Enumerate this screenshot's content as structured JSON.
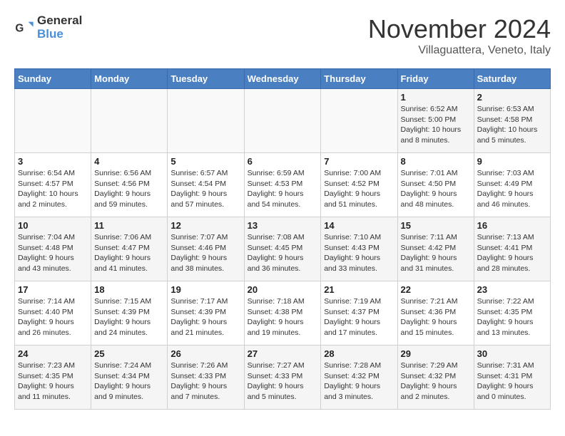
{
  "logo": {
    "line1": "General",
    "line2": "Blue"
  },
  "title": "November 2024",
  "subtitle": "Villaguattera, Veneto, Italy",
  "weekdays": [
    "Sunday",
    "Monday",
    "Tuesday",
    "Wednesday",
    "Thursday",
    "Friday",
    "Saturday"
  ],
  "weeks": [
    [
      {
        "day": "",
        "info": ""
      },
      {
        "day": "",
        "info": ""
      },
      {
        "day": "",
        "info": ""
      },
      {
        "day": "",
        "info": ""
      },
      {
        "day": "",
        "info": ""
      },
      {
        "day": "1",
        "info": "Sunrise: 6:52 AM\nSunset: 5:00 PM\nDaylight: 10 hours and 8 minutes."
      },
      {
        "day": "2",
        "info": "Sunrise: 6:53 AM\nSunset: 4:58 PM\nDaylight: 10 hours and 5 minutes."
      }
    ],
    [
      {
        "day": "3",
        "info": "Sunrise: 6:54 AM\nSunset: 4:57 PM\nDaylight: 10 hours and 2 minutes."
      },
      {
        "day": "4",
        "info": "Sunrise: 6:56 AM\nSunset: 4:56 PM\nDaylight: 9 hours and 59 minutes."
      },
      {
        "day": "5",
        "info": "Sunrise: 6:57 AM\nSunset: 4:54 PM\nDaylight: 9 hours and 57 minutes."
      },
      {
        "day": "6",
        "info": "Sunrise: 6:59 AM\nSunset: 4:53 PM\nDaylight: 9 hours and 54 minutes."
      },
      {
        "day": "7",
        "info": "Sunrise: 7:00 AM\nSunset: 4:52 PM\nDaylight: 9 hours and 51 minutes."
      },
      {
        "day": "8",
        "info": "Sunrise: 7:01 AM\nSunset: 4:50 PM\nDaylight: 9 hours and 48 minutes."
      },
      {
        "day": "9",
        "info": "Sunrise: 7:03 AM\nSunset: 4:49 PM\nDaylight: 9 hours and 46 minutes."
      }
    ],
    [
      {
        "day": "10",
        "info": "Sunrise: 7:04 AM\nSunset: 4:48 PM\nDaylight: 9 hours and 43 minutes."
      },
      {
        "day": "11",
        "info": "Sunrise: 7:06 AM\nSunset: 4:47 PM\nDaylight: 9 hours and 41 minutes."
      },
      {
        "day": "12",
        "info": "Sunrise: 7:07 AM\nSunset: 4:46 PM\nDaylight: 9 hours and 38 minutes."
      },
      {
        "day": "13",
        "info": "Sunrise: 7:08 AM\nSunset: 4:45 PM\nDaylight: 9 hours and 36 minutes."
      },
      {
        "day": "14",
        "info": "Sunrise: 7:10 AM\nSunset: 4:43 PM\nDaylight: 9 hours and 33 minutes."
      },
      {
        "day": "15",
        "info": "Sunrise: 7:11 AM\nSunset: 4:42 PM\nDaylight: 9 hours and 31 minutes."
      },
      {
        "day": "16",
        "info": "Sunrise: 7:13 AM\nSunset: 4:41 PM\nDaylight: 9 hours and 28 minutes."
      }
    ],
    [
      {
        "day": "17",
        "info": "Sunrise: 7:14 AM\nSunset: 4:40 PM\nDaylight: 9 hours and 26 minutes."
      },
      {
        "day": "18",
        "info": "Sunrise: 7:15 AM\nSunset: 4:39 PM\nDaylight: 9 hours and 24 minutes."
      },
      {
        "day": "19",
        "info": "Sunrise: 7:17 AM\nSunset: 4:39 PM\nDaylight: 9 hours and 21 minutes."
      },
      {
        "day": "20",
        "info": "Sunrise: 7:18 AM\nSunset: 4:38 PM\nDaylight: 9 hours and 19 minutes."
      },
      {
        "day": "21",
        "info": "Sunrise: 7:19 AM\nSunset: 4:37 PM\nDaylight: 9 hours and 17 minutes."
      },
      {
        "day": "22",
        "info": "Sunrise: 7:21 AM\nSunset: 4:36 PM\nDaylight: 9 hours and 15 minutes."
      },
      {
        "day": "23",
        "info": "Sunrise: 7:22 AM\nSunset: 4:35 PM\nDaylight: 9 hours and 13 minutes."
      }
    ],
    [
      {
        "day": "24",
        "info": "Sunrise: 7:23 AM\nSunset: 4:35 PM\nDaylight: 9 hours and 11 minutes."
      },
      {
        "day": "25",
        "info": "Sunrise: 7:24 AM\nSunset: 4:34 PM\nDaylight: 9 hours and 9 minutes."
      },
      {
        "day": "26",
        "info": "Sunrise: 7:26 AM\nSunset: 4:33 PM\nDaylight: 9 hours and 7 minutes."
      },
      {
        "day": "27",
        "info": "Sunrise: 7:27 AM\nSunset: 4:33 PM\nDaylight: 9 hours and 5 minutes."
      },
      {
        "day": "28",
        "info": "Sunrise: 7:28 AM\nSunset: 4:32 PM\nDaylight: 9 hours and 3 minutes."
      },
      {
        "day": "29",
        "info": "Sunrise: 7:29 AM\nSunset: 4:32 PM\nDaylight: 9 hours and 2 minutes."
      },
      {
        "day": "30",
        "info": "Sunrise: 7:31 AM\nSunset: 4:31 PM\nDaylight: 9 hours and 0 minutes."
      }
    ]
  ]
}
